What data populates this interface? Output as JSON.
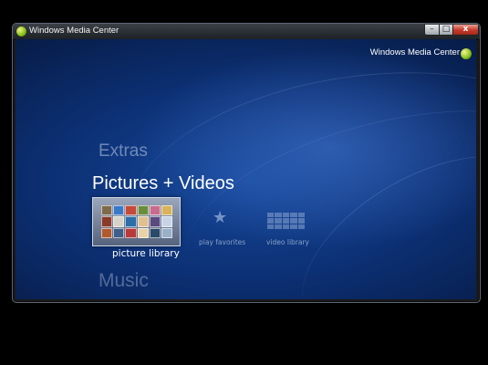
{
  "window": {
    "title": "Windows Media Center",
    "buttons": {
      "minimize": "–",
      "maximize": "□",
      "close": "x"
    }
  },
  "brand": {
    "text": "Windows Media Center",
    "logo_icon": "windows-media-center-logo"
  },
  "menu": {
    "above": "Extras",
    "current": "Pictures + Videos",
    "below": "Music"
  },
  "strip": {
    "items": [
      {
        "label": "picture library",
        "icon": "picture-thumbnails",
        "selected": true
      },
      {
        "label": "play favorites",
        "icon": "star-icon",
        "selected": false
      },
      {
        "label": "video library",
        "icon": "video-grid-icon",
        "selected": false
      }
    ]
  },
  "colors": {
    "background": "#0c2f72",
    "accent": "#ffffff",
    "close_button": "#c6392a"
  }
}
